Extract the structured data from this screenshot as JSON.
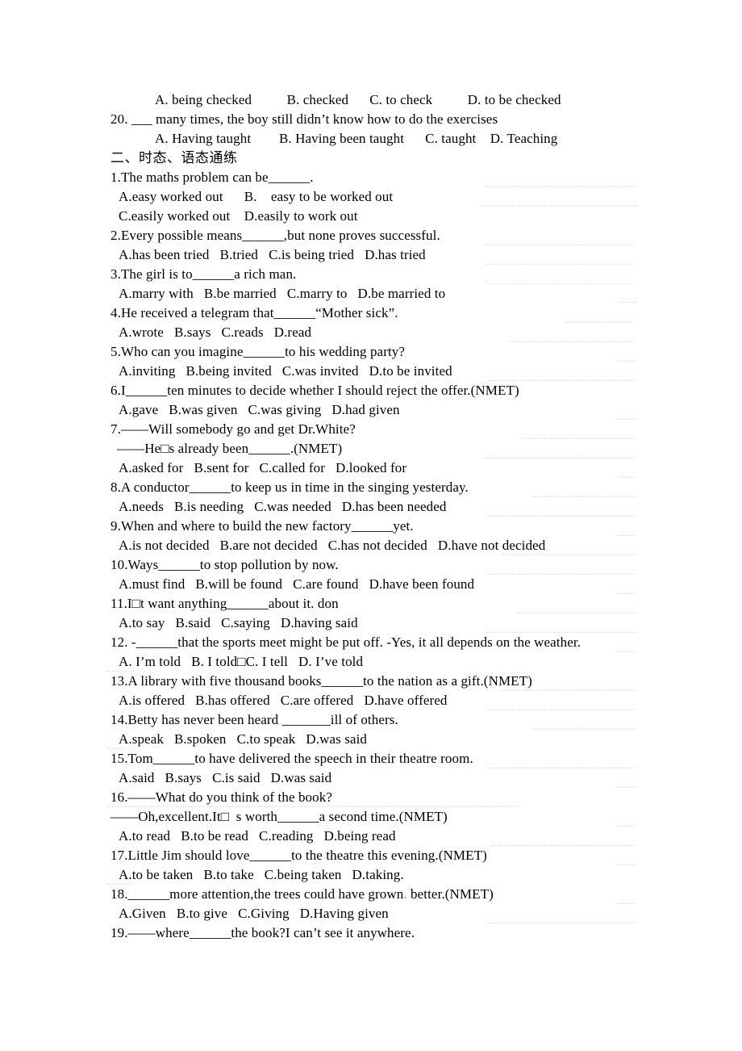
{
  "document": {
    "heading": "二、时态、语态通练",
    "carryover_question": {
      "options_line": "A. being checked          B. checked      C. to check          D. to be checked",
      "number": "20.",
      "stem": "20. ___ many times, the boy still didn’t know how to do the exercises",
      "options": "A. Having taught        B. Having been taught      C. taught    D. Teaching"
    },
    "questions": [
      {
        "stem": "1.The maths problem can be______.",
        "options_1": "A.easy worked out      B.    easy to be worked out",
        "options_2": "C.easily worked out    D.easily to work out"
      },
      {
        "stem": "2.Every possible means______,but none proves successful.",
        "options_1": "A.has been tried   B.tried   C.is being tried   D.has tried"
      },
      {
        "stem": "3.The girl is to______a rich man.",
        "options_1": "A.marry with   B.be married   C.marry to   D.be married to"
      },
      {
        "stem": "4.He received a telegram that______“Mother sick”.",
        "options_1": "A.wrote   B.says   C.reads   D.read"
      },
      {
        "stem": "5.Who can you imagine______to his wedding party?",
        "options_1": "A.inviting   B.being invited   C.was invited   D.to be invited"
      },
      {
        "stem": "6.I______ten minutes to decide whether I should reject the offer.(NMET)",
        "options_1": "A.gave   B.was given   C.was giving   D.had given"
      },
      {
        "stem": "7.——Will somebody go and get Dr.White?",
        "stem_cont": "——He□s already been______.(NMET)",
        "options_1": "A.asked for   B.sent for   C.called for   D.looked for"
      },
      {
        "stem": "8.A conductor______to keep us in time in the singing yesterday.",
        "options_1": "A.needs   B.is needing   C.was needed   D.has been needed"
      },
      {
        "stem": "9.When and where to build the new factory______yet.",
        "options_1": "A.is not decided   B.are not decided   C.has not decided   D.have not decided"
      },
      {
        "stem": "10.Ways______to stop pollution by now.",
        "options_1": "A.must find   B.will be found   C.are found   D.have been found"
      },
      {
        "stem": "11.I□t want anything______about it. don",
        "options_1": "A.to say   B.said   C.saying   D.having said"
      },
      {
        "stem": "12. -______that the sports meet might be put off. -Yes, it all depends on the weather.",
        "options_1": "A. I’m told   B. I told□C. I tell   D. I’ve told"
      },
      {
        "stem": "13.A library with five thousand books______to the nation as a gift.(NMET)",
        "options_1": "A.is offered   B.has offered   C.are offered   D.have offered"
      },
      {
        "stem": "14.Betty has never been heard _______ill of others.",
        "options_1": "A.speak   B.spoken   C.to speak   D.was said"
      },
      {
        "stem": "15.Tom______to have delivered the speech in their theatre room.",
        "options_1": "A.said   B.says   C.is said   D.was said"
      },
      {
        "stem": "16.——What do you think of the book?",
        "stem_cont": "——Oh,excellent.It□  s worth______a second time.(NMET)",
        "options_1": "A.to read   B.to be read   C.reading   D.being read"
      },
      {
        "stem": "17.Little Jim should love______to the theatre this evening.(NMET)",
        "options_1": "A.to be taken   B.to take   C.being taken   D.taking."
      },
      {
        "stem_pre": "18.______more attention,the trees could have grown",
        "stem_speck": ".",
        "stem_post": " better.(NMET)",
        "options_1": "A.Given   B.to give   C.Giving   D.Having given"
      },
      {
        "stem": "19.——where______the book?I can’t see it anywhere.",
        "options_1": ""
      }
    ]
  }
}
